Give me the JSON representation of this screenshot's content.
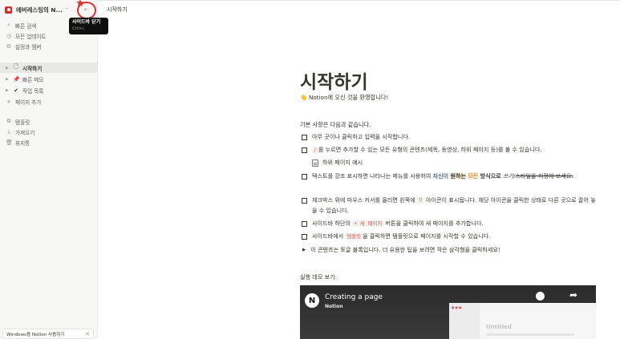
{
  "sidebar": {
    "workspace_name": "에버레스팅의 N...",
    "collapse_glyph": "«",
    "tooltip": {
      "title": "사이드바 닫기",
      "shortcut": "Ctrl+\\"
    },
    "top_items": [
      {
        "icon": "search-icon",
        "label": "빠른 검색"
      },
      {
        "icon": "clock-icon",
        "label": "모든 업데이트"
      },
      {
        "icon": "gear-icon",
        "label": "설정과 멤버"
      }
    ],
    "pages": [
      {
        "icon": "page-icon",
        "label": "시작하기",
        "active": true
      },
      {
        "icon": "pin-icon",
        "label": "빠른 메모",
        "active": false
      },
      {
        "icon": "check-icon",
        "label": "작업 목록",
        "active": false
      }
    ],
    "add_page": "페이지 추가",
    "bottom_items": [
      {
        "icon": "template-icon",
        "label": "템플릿"
      },
      {
        "icon": "import-icon",
        "label": "가져오기"
      },
      {
        "icon": "trash-icon",
        "label": "휴지통"
      }
    ],
    "banner": {
      "text": "Windows용 Notion 사용하기",
      "close": "✕"
    }
  },
  "topbar": {
    "breadcrumb": "시작하기"
  },
  "page": {
    "title": "시작하기",
    "welcome": "Notion에 오신 것을 환영합니다!",
    "intro": "기본 사항은 다음과 같습니다.",
    "todos": {
      "t1": "아무 곳이나 클릭하고 입력을 시작합니다.",
      "t2_code": "/",
      "t2_rest": "를 누르면 추가할 수 있는 모든 유형의 콘텐츠(제목, 동영상, 하위 페이지 등)를 볼 수 있습니다.",
      "subpage": "하위 페이지 예시",
      "t3_a": "텍스트를 강조 표시하면 나타나는 메뉴를 사용하여 ",
      "t3_b": "자신이",
      "t3_c": " ",
      "t3_d": "원하는",
      "t3_e": " ",
      "t3_f": "모든",
      "t3_g": " ",
      "t3_h": "방식으로",
      "t3_i": " ",
      "t3_j": "쓰기",
      "t3_k": "/",
      "t3_l": "스타일을 지정해 보세요.",
      "t4_a": "체크박스 위에 마우스 커서를 올리면 왼쪽에 ",
      "t4_code": "⠿",
      "t4_b": " 아이콘이 표시됩니다. 해당 아이콘을 클릭한 상태로 다른 곳으로 끌어 놓을 수 있습니다.",
      "t5_a": "사이드바 하단의 ",
      "t5_code": "+ 새 페이지",
      "t5_b": " 버튼을 클릭하여 새 페이지를 추가합니다.",
      "t6_a": "사이드바에서 ",
      "t6_code": "템플릿",
      "t6_b": "을 클릭하면 템플릿으로 페이지를 시작할 수 있습니다."
    },
    "toggle": "이 콘텐츠는 토글 블록입니다. 더 유용한 팁을 보려면 작은 삼각형을 클릭하세요!",
    "demo_label": "실행 데모 보기:",
    "video": {
      "title": "Creating a page",
      "channel": "Notion",
      "logo": "N",
      "inner_title": "Untitled"
    }
  }
}
